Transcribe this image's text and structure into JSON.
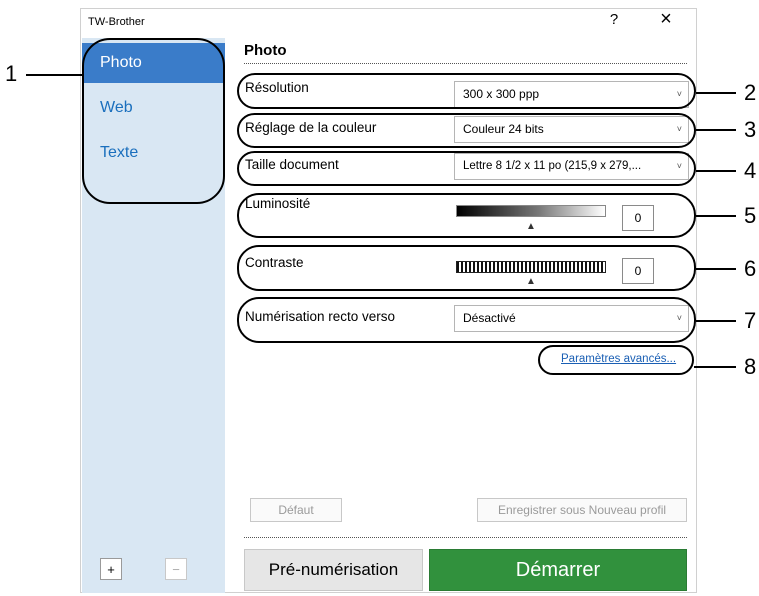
{
  "window": {
    "title": "TW-Brother",
    "help_glyph": "?",
    "close_glyph": "×"
  },
  "sidebar": {
    "items": [
      {
        "label": "Photo",
        "selected": true
      },
      {
        "label": "Web",
        "selected": false
      },
      {
        "label": "Texte",
        "selected": false
      }
    ],
    "add_label": "+",
    "remove_label": "−"
  },
  "main": {
    "title": "Photo",
    "resolution": {
      "label": "Résolution",
      "value": "300 x 300 ppp"
    },
    "color": {
      "label": "Réglage de la couleur",
      "value": "Couleur 24 bits"
    },
    "doc_size": {
      "label": "Taille document",
      "value": "Lettre 8 1/2 x 11 po (215,9 x 279,..."
    },
    "brightness": {
      "label": "Luminosité",
      "value": "0",
      "level": 0.5
    },
    "contrast": {
      "label": "Contraste",
      "value": "0",
      "level": 0.5
    },
    "duplex": {
      "label": "Numérisation recto verso",
      "value": "Désactivé"
    },
    "advanced_link": "Paramètres avancés...",
    "default_button": "Défaut",
    "save_profile_button": "Enregistrer sous Nouveau profil",
    "prescan_button": "Pré-numérisation",
    "start_button": "Démarrer",
    "chevron_glyph": "˅",
    "thumb_glyph": "▲"
  },
  "callouts": [
    "1",
    "2",
    "3",
    "4",
    "5",
    "6",
    "7",
    "8"
  ],
  "colors": {
    "sidebar_bg": "#d9e7f3",
    "selected_bg": "#3a7cc9",
    "start_green": "#31913d",
    "link": "#1a5fb4"
  }
}
